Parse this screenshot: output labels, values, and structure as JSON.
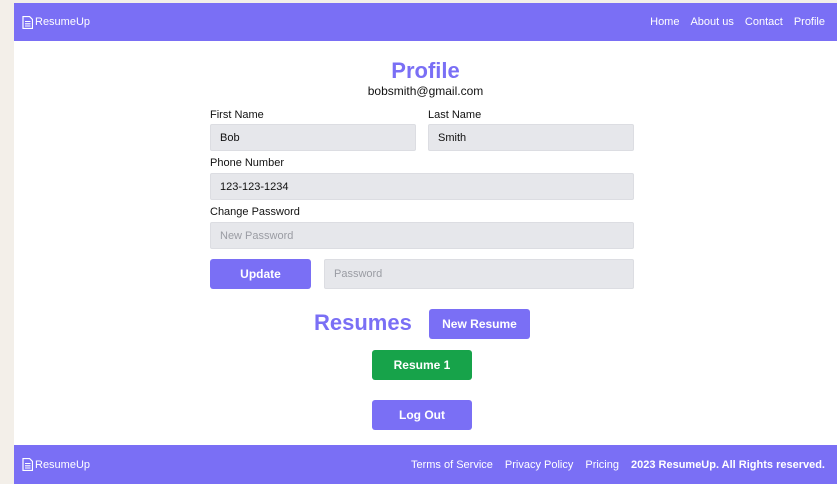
{
  "nav": {
    "brand": "ResumeUp",
    "links": [
      "Home",
      "About us",
      "Contact",
      "Profile"
    ]
  },
  "profile": {
    "title": "Profile",
    "email": "bobsmith@gmail.com",
    "first_name_label": "First Name",
    "first_name_value": "Bob",
    "last_name_label": "Last Name",
    "last_name_value": "Smith",
    "phone_label": "Phone Number",
    "phone_value": "123-123-1234",
    "change_password_label": "Change Password",
    "new_password_placeholder": "New Password",
    "password_placeholder": "Password",
    "update_label": "Update"
  },
  "resumes": {
    "title": "Resumes",
    "new_resume_label": "New Resume",
    "items": [
      "Resume 1"
    ],
    "logout_label": "Log Out"
  },
  "footer": {
    "brand": "ResumeUp",
    "links": [
      "Terms of Service",
      "Privacy Policy",
      "Pricing"
    ],
    "copyright": "2023 ResumeUp. All Rights reserved."
  },
  "colors": {
    "brand_purple": "#7a6ff5",
    "resume_green": "#17a34a",
    "input_bg": "#e6e7eb"
  }
}
